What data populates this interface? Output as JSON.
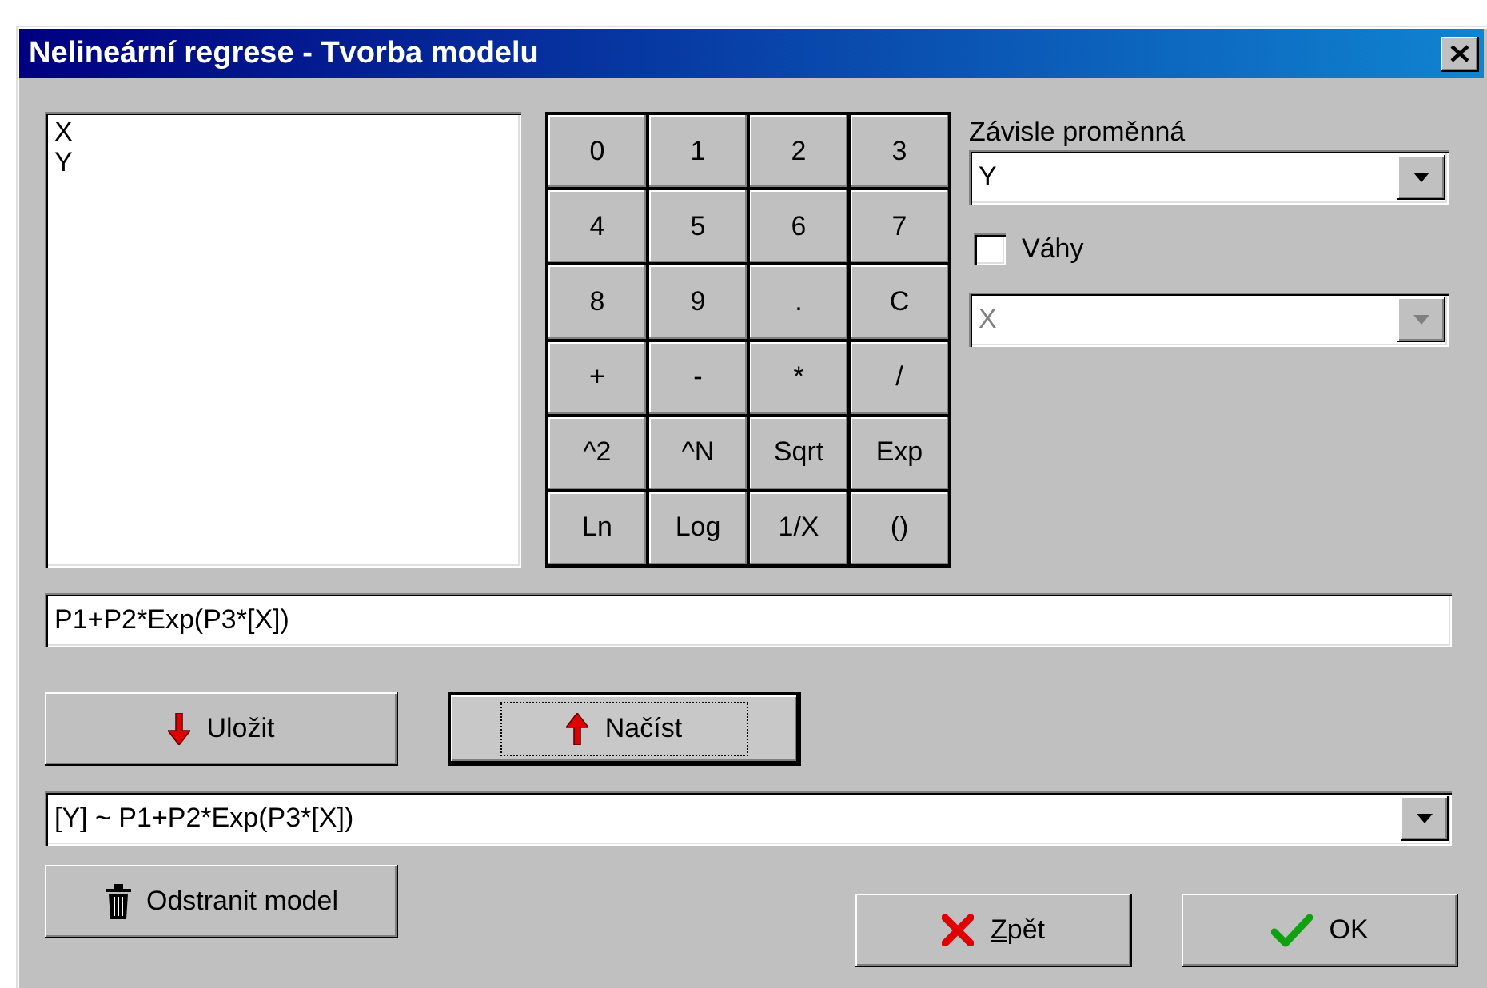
{
  "window": {
    "title": "Nelineární regrese - Tvorba modelu"
  },
  "variables": [
    {
      "label": "X",
      "selected": false
    },
    {
      "label": "Y",
      "selected": false
    }
  ],
  "keypad": [
    "0",
    "1",
    "2",
    "3",
    "4",
    "5",
    "6",
    "7",
    "8",
    "9",
    ".",
    "C",
    "+",
    "-",
    "*",
    "/",
    "^2",
    "^N",
    "Sqrt",
    "Exp",
    "Ln",
    "Log",
    "1/X",
    "()"
  ],
  "dependent": {
    "label": "Závisle proměnná",
    "value": "Y"
  },
  "weights": {
    "label": "Váhy",
    "checked": false
  },
  "weight_variable": {
    "value": "X",
    "disabled": true
  },
  "formula": {
    "value": "P1+P2*Exp(P3*[X])"
  },
  "buttons": [
    {
      "kind": "save",
      "label": "Uložit",
      "focused": false
    },
    {
      "kind": "load",
      "label": "Načíst",
      "focused": true
    }
  ],
  "model": {
    "value": "[Y] ~ P1+P2*Exp(P3*[X])"
  },
  "remove_button": {
    "label": "Odstranit model"
  },
  "dialog_buttons": [
    {
      "kind": "cancel",
      "label": "Zpět",
      "underline_first": true
    },
    {
      "kind": "ok",
      "label": "OK"
    }
  ]
}
